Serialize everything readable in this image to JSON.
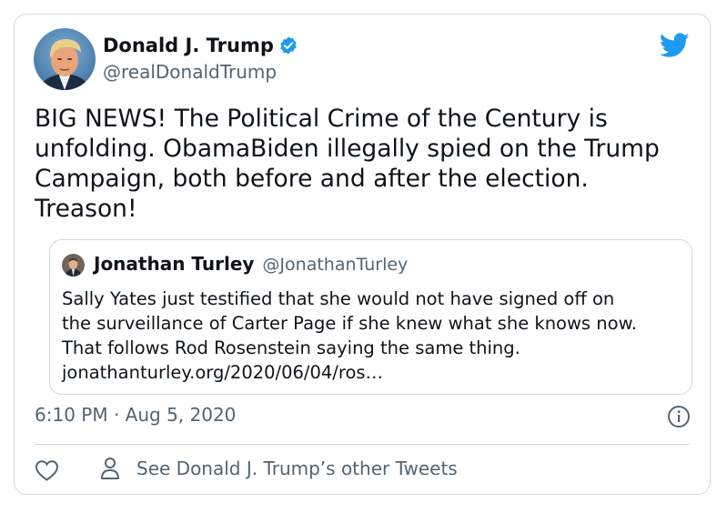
{
  "author": {
    "display_name": "Donald J. Trump",
    "handle": "@realDonaldTrump",
    "verified": true,
    "avatar_icon": "profile-photo"
  },
  "tweet": {
    "text": "BIG NEWS! The Political Crime of the Century is unfolding. ObamaBiden illegally spied on the Trump Campaign, both before and after the election. Treason!",
    "timestamp": "6:10 PM · Aug 5, 2020"
  },
  "quoted_tweet": {
    "display_name": "Jonathan Turley",
    "handle": "@JonathanTurley",
    "lines": [
      "Sally Yates just testified that she would not have signed off on",
      "the surveillance of Carter Page if she knew what she knows now.",
      "That follows Rod Rosenstein saying the same thing.",
      "jonathanturley.org/2020/06/04/ros…"
    ]
  },
  "footer": {
    "other_tweets_label": "See Donald J. Trump’s other Tweets"
  },
  "icons": {
    "brand": "twitter-bird-icon",
    "verified": "verified-badge-icon",
    "info": "info-icon",
    "like": "heart-icon",
    "profile": "person-icon"
  },
  "colors": {
    "brand_blue": "#1d9bf0",
    "text_primary": "#0f1419",
    "text_secondary": "#536471",
    "border": "#cfd9de"
  }
}
